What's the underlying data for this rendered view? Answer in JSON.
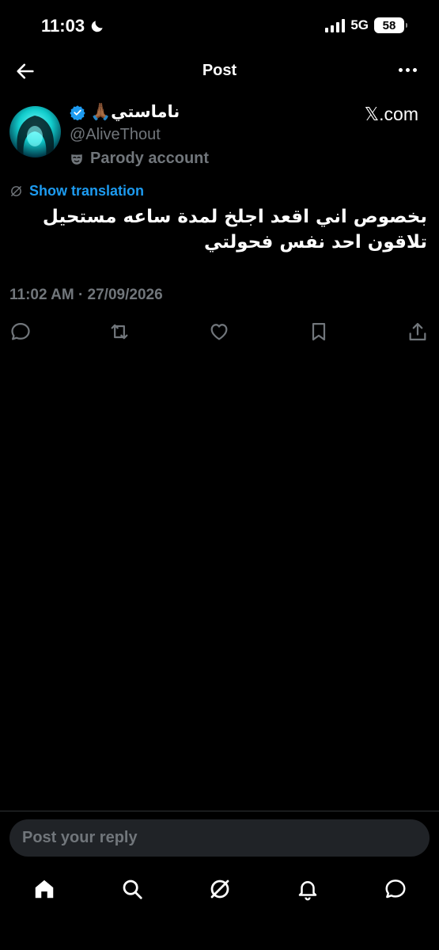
{
  "status_bar": {
    "time": "11:03",
    "network": "5G",
    "battery": "58"
  },
  "top_nav": {
    "title": "Post",
    "back_icon": "arrow-left-icon",
    "more_icon": "more-horizontal-icon"
  },
  "post": {
    "display_name": "ناماستي🙏🏾",
    "verified": true,
    "handle": "@AliveThout",
    "parody_label": "Parody account",
    "source": "𝕏.com",
    "translate_label": "Show translation",
    "text_lines": [
      "بخصوص اني اقعد اجلخ لمدة ساعه مستحيل",
      "تلاقون احد نفس فحولتي"
    ],
    "timestamp": "11:02 AM · 27/09/2026"
  },
  "actions": [
    "reply-icon",
    "repost-icon",
    "like-icon",
    "bookmark-icon",
    "share-icon"
  ],
  "reply": {
    "placeholder": "Post your reply"
  },
  "bottom_nav": [
    "home-icon",
    "search-icon",
    "grok-icon",
    "notifications-icon",
    "messages-icon"
  ],
  "colors": {
    "background": "#000000",
    "accent": "#1d9bf0",
    "muted": "#71767b",
    "text": "#e7e9ea",
    "input_bg": "#202327"
  }
}
